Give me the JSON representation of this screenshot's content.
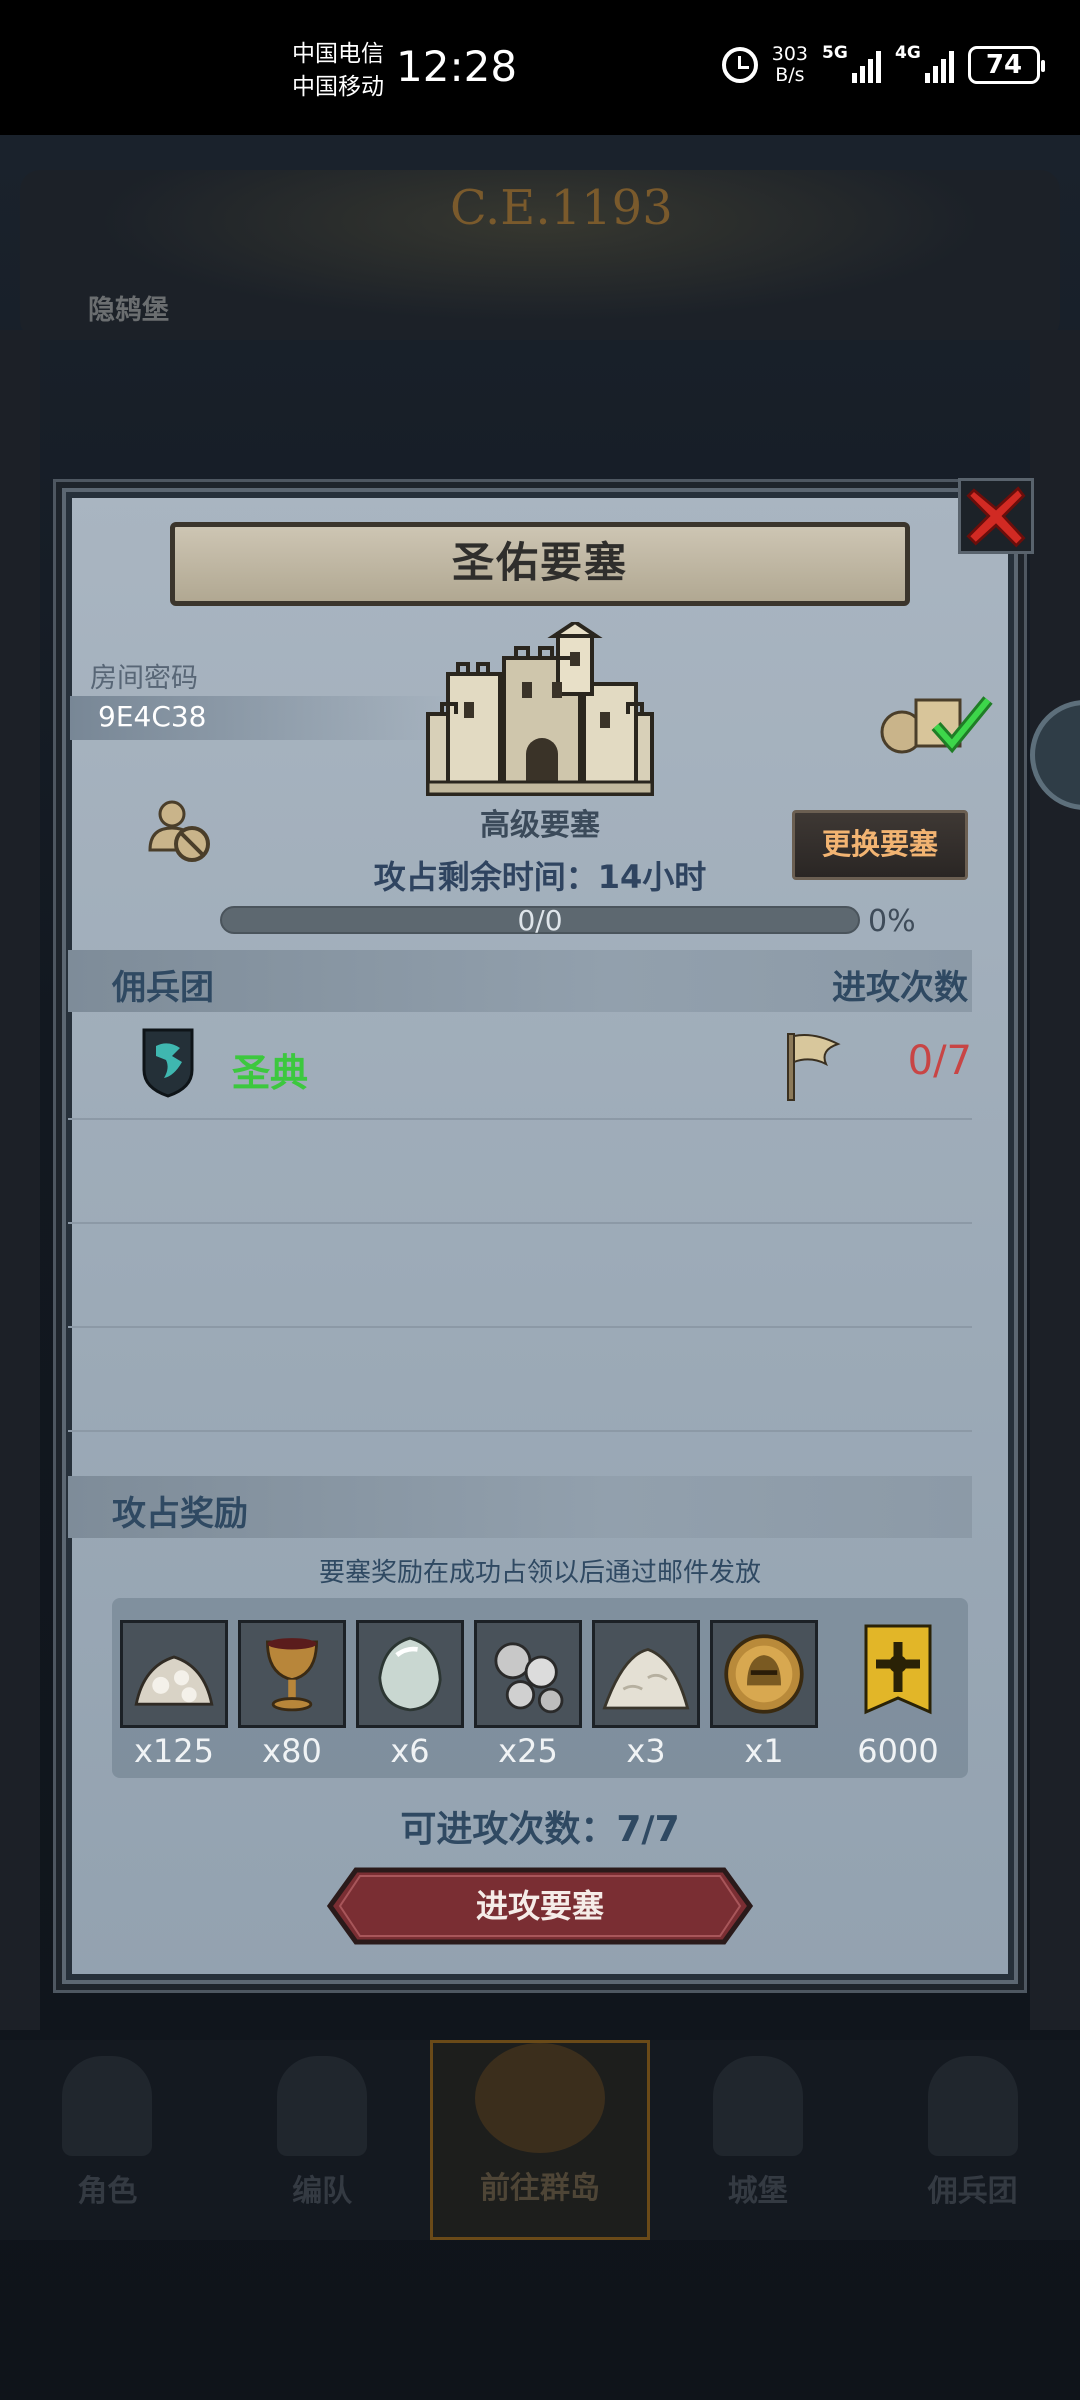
{
  "status_bar": {
    "carrier_1": "中国电信",
    "carrier_2": "中国移动",
    "time": "12:28",
    "net_speed_value": "303",
    "net_speed_unit": "B/s",
    "signal_1_tag": "5G",
    "signal_2_tag": "4G",
    "battery": "74"
  },
  "background": {
    "era": "C.E.1193",
    "town_name": "隐鸫堡"
  },
  "nav": {
    "items": [
      {
        "label": "角色",
        "icon": "knight-icon"
      },
      {
        "label": "编队",
        "icon": "helmet-icon"
      },
      {
        "label": "前往群岛",
        "icon": "island-icon"
      },
      {
        "label": "城堡",
        "icon": "castle-icon"
      },
      {
        "label": "佣兵团",
        "icon": "ship-icon"
      }
    ],
    "active": "前往群岛"
  },
  "dialog": {
    "title": "圣佑要塞",
    "room_password_label": "房间密码",
    "room_password": "9E4C38",
    "fortress_level": "高级要塞",
    "change_button": "更换要塞",
    "time_remaining": "攻占剩余时间：14小时",
    "progress_text": "0/0",
    "progress_value": 0,
    "progress_percent": "0%",
    "list_header_left": "佣兵团",
    "list_header_right": "进攻次数",
    "guild": {
      "name": "圣典",
      "attacks": "0/7",
      "shield_icon": "dragon-shield-icon",
      "flag_icon": "flag-icon"
    },
    "reward_header": "攻占奖励",
    "reward_note": "要塞奖励在成功占领以后通过邮件发放",
    "rewards": [
      {
        "icon": "ore-pile-icon",
        "qty": "x125"
      },
      {
        "icon": "goblet-icon",
        "qty": "x80"
      },
      {
        "icon": "gem-stone-icon",
        "qty": "x6"
      },
      {
        "icon": "silver-orbs-icon",
        "qty": "x25"
      },
      {
        "icon": "powder-pile-icon",
        "qty": "x3"
      },
      {
        "icon": "helmet-medal-icon",
        "qty": "x1"
      },
      {
        "icon": "banner-badge-icon",
        "qty": "6000"
      }
    ],
    "attacks_available": "可进攻次数：7/7",
    "attack_button": "进攻要塞",
    "colors": {
      "guild_name": "#3cc83e",
      "attack_count": "#c84545",
      "change_button_text": "#f2b472",
      "attack_button_bg": "#7a2e33"
    }
  }
}
